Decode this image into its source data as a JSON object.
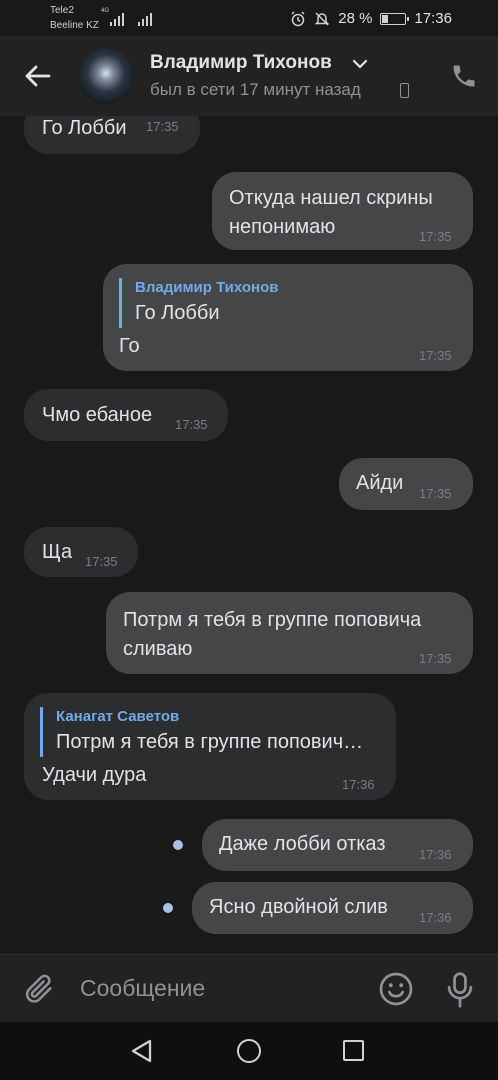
{
  "status_bar": {
    "carrier1": "Tele2",
    "carrier2": "Beeline KZ",
    "network": "4G",
    "battery": "28 %",
    "battery_level": 0.28,
    "time": "17:36"
  },
  "header": {
    "contact_name": "Владимир Тихонов",
    "last_seen": "был в сети 17 минут назад"
  },
  "messages": [
    {
      "dir": "in",
      "text": "Го Лобби",
      "time": "17:35"
    },
    {
      "dir": "out",
      "lines": [
        "Откуда нашел скрины",
        "непонимаю"
      ],
      "time": "17:35"
    },
    {
      "dir": "out",
      "reply_name": "Владимир Тихонов",
      "reply_text": "Го Лобби",
      "text": "Го",
      "time": "17:35"
    },
    {
      "dir": "in",
      "text": "Чмо ебаное",
      "time": "17:35"
    },
    {
      "dir": "out",
      "text": "Айди",
      "time": "17:35"
    },
    {
      "dir": "in",
      "text": "Ща",
      "time": "17:35"
    },
    {
      "dir": "out",
      "lines": [
        "Потрм я тебя в группе поповича",
        "сливаю"
      ],
      "time": "17:35"
    },
    {
      "dir": "in",
      "reply_name": "Канагат Саветов",
      "reply_text": "Потрм я тебя в группе попович…",
      "text": "Удачи дура",
      "time": "17:36"
    },
    {
      "dir": "out",
      "text": "Даже лобби отказ",
      "time": "17:36",
      "unread": true
    },
    {
      "dir": "out",
      "text": "Ясно двойной слив",
      "time": "17:36",
      "unread": true
    }
  ],
  "composer": {
    "placeholder": "Сообщение"
  },
  "icons": {
    "back": "arrow-left-icon",
    "call": "phone-icon",
    "attach": "paperclip-icon",
    "emoji": "smile-icon",
    "mic": "microphone-icon"
  },
  "colors": {
    "background": "#19191a",
    "incoming_bubble": "#2c2d2e",
    "outgoing_bubble": "#454647",
    "accent": "#71aaeb"
  }
}
